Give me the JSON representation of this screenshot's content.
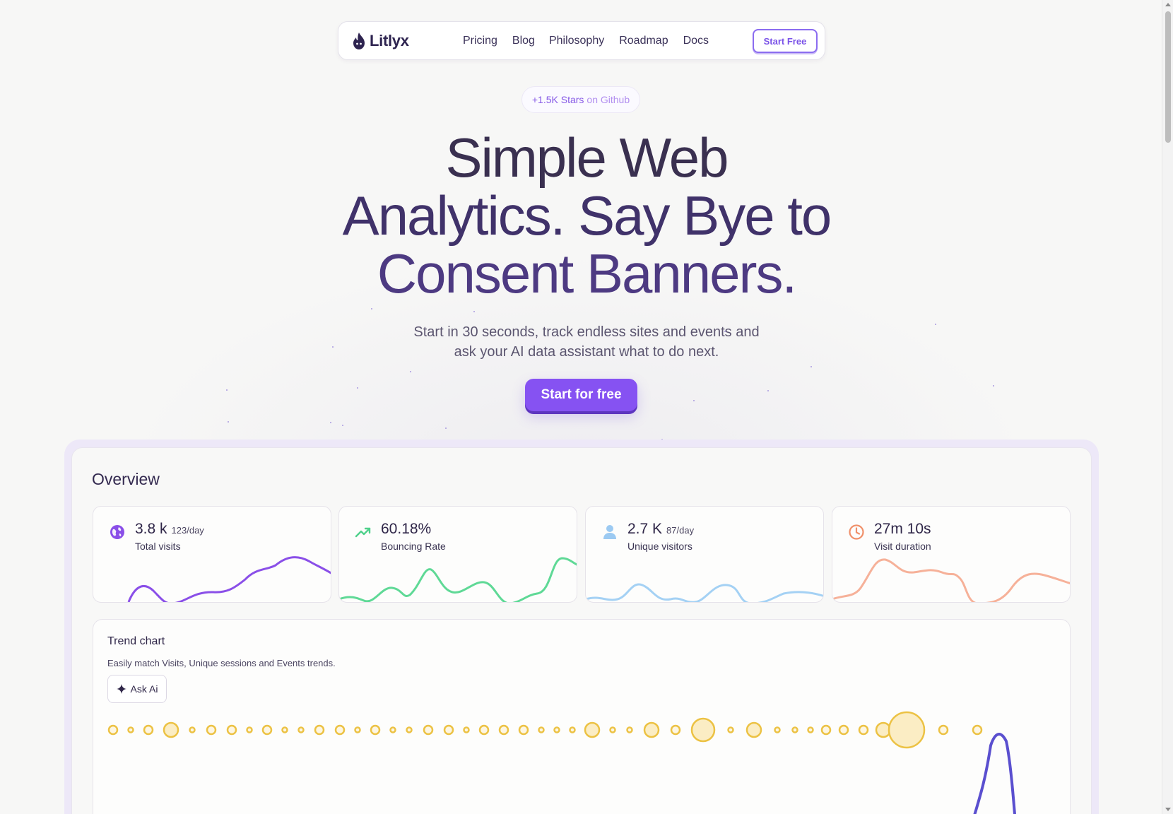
{
  "nav": {
    "brand": "Litlyx",
    "links": [
      "Pricing",
      "Blog",
      "Philosophy",
      "Roadmap",
      "Docs"
    ],
    "cta": "Start Free"
  },
  "badge": {
    "part1": "+1.5K Stars",
    "part2": "on Github"
  },
  "hero": {
    "line1": "Simple Web",
    "line2": "Analytics. Say Bye to",
    "line3": "Consent Banners.",
    "subtitle_line1": "Start in 30 seconds, track endless sites and events and",
    "subtitle_line2": "ask your AI data assistant what to do next.",
    "cta": "Start for free"
  },
  "dashboard": {
    "title": "Overview",
    "stats": [
      {
        "value": "3.8 k",
        "sub": "123/day",
        "label": "Total visits",
        "icon": "globe-icon",
        "color": "#8a4fe8"
      },
      {
        "value": "60.18%",
        "sub": "",
        "label": "Bouncing Rate",
        "icon": "trending-up-icon",
        "color": "#4fd18b"
      },
      {
        "value": "2.7 K",
        "sub": "87/day",
        "label": "Unique visitors",
        "icon": "user-icon",
        "color": "#9ccaf2"
      },
      {
        "value": "27m 10s",
        "sub": "",
        "label": "Visit duration",
        "icon": "clock-icon",
        "color": "#f4a383"
      }
    ],
    "trend": {
      "title": "Trend chart",
      "description": "Easily match Visits, Unique sessions and Events trends.",
      "ask_ai": "Ask Ai",
      "bubble_color": "#ecc244",
      "line_color": "#5a4fcf",
      "bubbles": [
        2,
        1,
        2,
        4,
        1,
        2,
        2,
        1,
        2,
        1,
        1,
        2,
        2,
        1,
        2,
        1,
        1,
        2,
        2,
        1,
        2,
        2,
        2,
        1,
        1,
        1,
        3,
        1,
        1,
        4,
        2,
        6,
        1,
        3,
        1,
        1,
        1,
        2,
        2,
        2,
        3,
        8,
        2,
        2
      ]
    }
  }
}
